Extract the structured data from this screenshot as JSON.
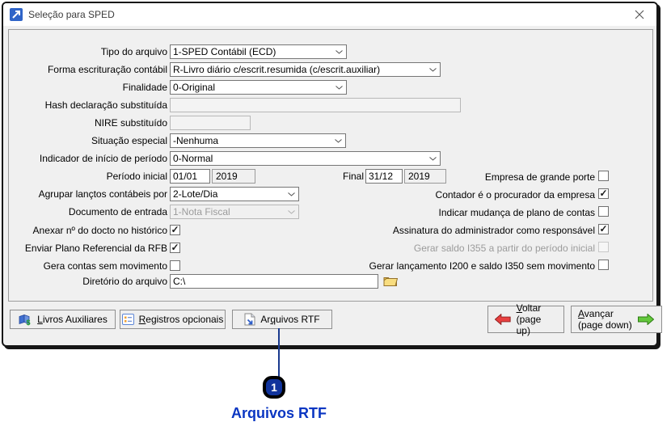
{
  "glyphs": {
    "check": "✓"
  },
  "window": {
    "title": "Seleção para SPED"
  },
  "form": {
    "tipo_label": "Tipo do arquivo",
    "tipo_value": "1-SPED Contábil (ECD)",
    "forma_label": "Forma escrituração contábil",
    "forma_value": "R-Livro diário c/escrit.resumida (c/escrit.auxiliar)",
    "finalidade_label": "Finalidade",
    "finalidade_value": "0-Original",
    "hash_label": "Hash declaração substituída",
    "hash_value": "",
    "nire_label": "NIRE substituído",
    "nire_value": "",
    "situacao_label": "Situação especial",
    "situacao_value": "-Nenhuma",
    "indicador_label": "Indicador de início de período",
    "indicador_value": "0-Normal",
    "periodo_label": "Período inicial",
    "periodo_inicial_dia": "01/01",
    "periodo_inicial_ano": "2019",
    "final_label": "Final",
    "periodo_final_dia": "31/12",
    "periodo_final_ano": "2019",
    "agrupar_label": "Agrupar lançtos contábeis por",
    "agrupar_value": "2-Lote/Dia",
    "documento_label": "Documento de entrada",
    "documento_value": "1-Nota Fiscal",
    "anexar_label": "Anexar nº do docto no histórico",
    "enviar_label": "Enviar Plano Referencial da RFB",
    "gera_label": "Gera contas sem movimento",
    "diretorio_label": "Diretório do arquivo",
    "diretorio_value": "C:\\",
    "right_checks": [
      {
        "label": "Empresa de grande porte",
        "checked": false
      },
      {
        "label": "Contador é o procurador da empresa",
        "checked": true
      },
      {
        "label": "Indicar mudança de plano de contas",
        "checked": false
      },
      {
        "label": "Assinatura do administrador como responsável",
        "checked": true
      },
      {
        "label": "Gerar saldo I355 a partir do período inicial",
        "checked": false,
        "disabled": true
      },
      {
        "label": "Gerar lançamento I200 e saldo I350 sem movimento",
        "checked": false
      }
    ]
  },
  "buttons": {
    "livros": {
      "pre": "",
      "u": "L",
      "post": "ivros Auxiliares"
    },
    "registros": {
      "pre": "",
      "u": "R",
      "post": "egistros opcionais"
    },
    "arquivos": {
      "pre": "Ar",
      "u": "q",
      "post": "uivos RTF"
    },
    "voltar": {
      "u": "V",
      "post": "oltar",
      "line2": "(page up)"
    },
    "avancar": {
      "u": "A",
      "post": "vançar",
      "line2": "(page down)"
    }
  },
  "annotation": {
    "number": "1",
    "label": "Arquivos RTF",
    "accent": "#0a36c2"
  }
}
